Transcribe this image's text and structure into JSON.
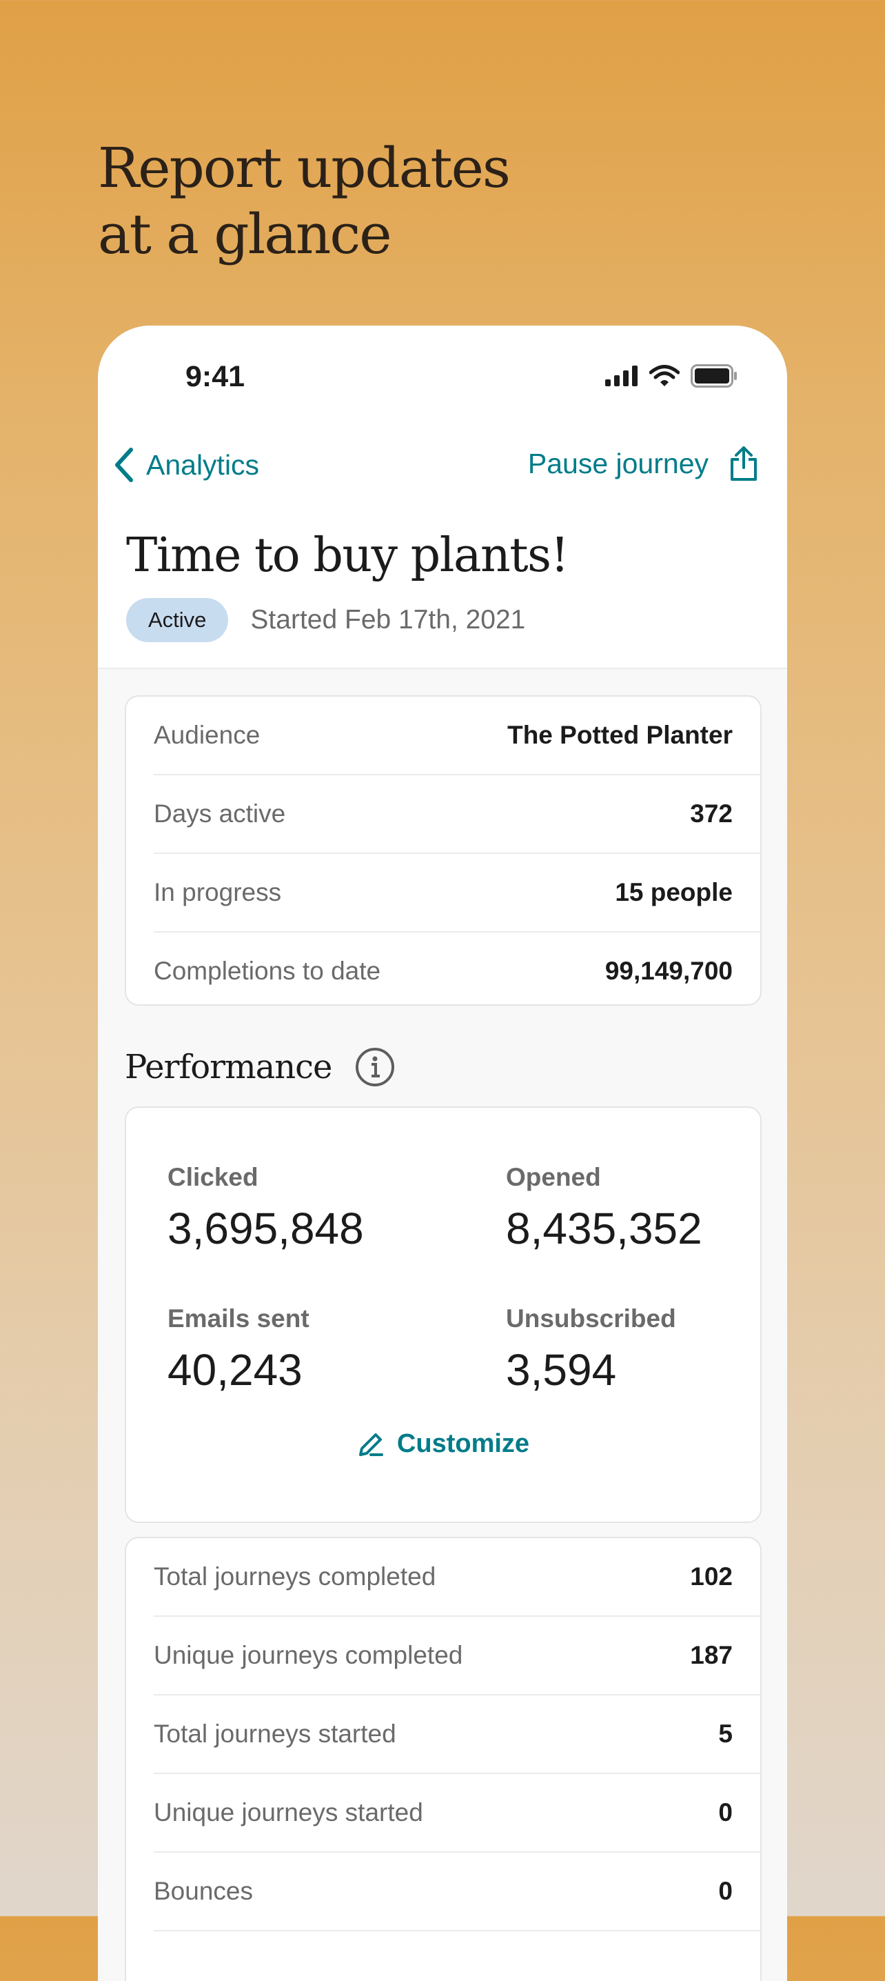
{
  "headline": [
    "Report updates",
    "at a glance"
  ],
  "status_bar": {
    "time": "9:41"
  },
  "nav": {
    "back_label": "Analytics",
    "pause_label": "Pause journey"
  },
  "journey": {
    "title": "Time to buy plants!",
    "status": "Active",
    "started": "Started Feb 17th, 2021"
  },
  "summary": [
    {
      "label": "Audience",
      "value": "The Potted Planter"
    },
    {
      "label": "Days active",
      "value": "372"
    },
    {
      "label": "In progress",
      "value": "15 people"
    },
    {
      "label": "Completions to date",
      "value": "99,149,700"
    }
  ],
  "performance": {
    "title": "Performance",
    "metrics": [
      {
        "label": "Clicked",
        "value": "3,695,848"
      },
      {
        "label": "Opened",
        "value": "8,435,352"
      },
      {
        "label": "Emails sent",
        "value": "40,243"
      },
      {
        "label": "Unsubscribed",
        "value": "3,594"
      }
    ],
    "customize_label": "Customize"
  },
  "stats": [
    {
      "label": "Total journeys completed",
      "value": "102"
    },
    {
      "label": "Unique journeys completed",
      "value": "187"
    },
    {
      "label": "Total journeys started",
      "value": "5"
    },
    {
      "label": "Unique journeys started",
      "value": "0"
    },
    {
      "label": "Bounces",
      "value": "0"
    },
    {
      "label": "",
      "value": ""
    }
  ],
  "colors": {
    "accent": "#007c89",
    "badge": "#c8dcf0",
    "background_top": "#e0a046",
    "background_bottom": "#e0d6cb"
  },
  "icons": [
    "signal-icon",
    "wifi-icon",
    "battery-icon",
    "chevron-left-icon",
    "share-icon",
    "info-icon",
    "pencil-icon"
  ]
}
